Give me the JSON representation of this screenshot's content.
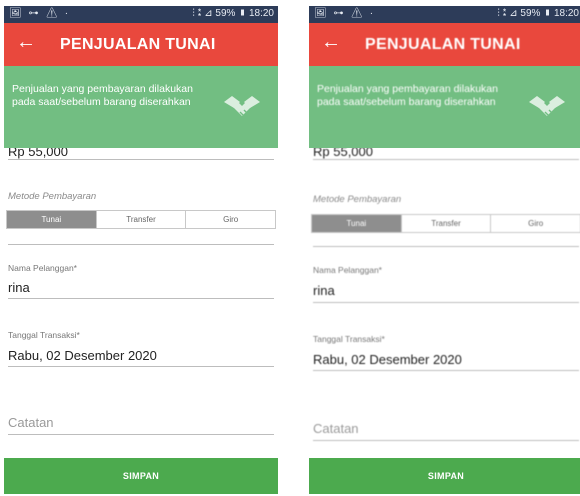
{
  "screens": [
    {
      "status": {
        "left_icons": "🖼 ⊶ ⚠ ·",
        "right": "⫶ ⁑ ⊿ 59% ▮ 18:20"
      },
      "appbar": {
        "back_icon": "back-arrow-icon",
        "title": "PENJUALAN TUNAI"
      },
      "banner": {
        "text": "Penjualan yang pembayaran dilakukan pada saat/sebelum barang diserahkan",
        "icon": "handshake-icon"
      },
      "amount_value": "Rp 55,000",
      "payment": {
        "label": "Metode Pembayaran",
        "options": [
          "Tunai",
          "Transfer",
          "Giro"
        ],
        "selected": "Tunai"
      },
      "customer": {
        "label": "Nama Pelanggan*",
        "value": "rina"
      },
      "date": {
        "label": "Tanggal Transaksi*",
        "value": "Rabu, 02 Desember 2020"
      },
      "notes": {
        "placeholder": "Catatan"
      },
      "save_label": "SIMPAN"
    },
    {
      "status": {
        "left_icons": "🖼 ⊶ ⚠ ·",
        "right": "⫶ ⁑ ⊿ 59% ▮ 18:20"
      },
      "appbar": {
        "back_icon": "back-arrow-icon",
        "title": "PENJUALAN TUNAI"
      },
      "banner": {
        "text": "Penjualan yang pembayaran dilakukan pada saat/sebelum barang diserahkan",
        "icon": "handshake-icon"
      },
      "amount_value": "Rp 55,000",
      "payment": {
        "label": "Metode Pembayaran",
        "options": [
          "Tunai",
          "Transfer",
          "Giro"
        ],
        "selected": "Tunai"
      },
      "customer": {
        "label": "Nama Pelanggan*",
        "value": "rina"
      },
      "date": {
        "label": "Tanggal Transaksi*",
        "value": "Rabu, 02 Desember 2020"
      },
      "notes": {
        "placeholder": "Catatan"
      },
      "save_label": "SIMPAN"
    }
  ],
  "colors": {
    "status_bar": "#2d3c59",
    "app_bar": "#e9483d",
    "banner": "#72be82",
    "save_button": "#4caa4e",
    "segment_active": "#8e8e8e"
  }
}
